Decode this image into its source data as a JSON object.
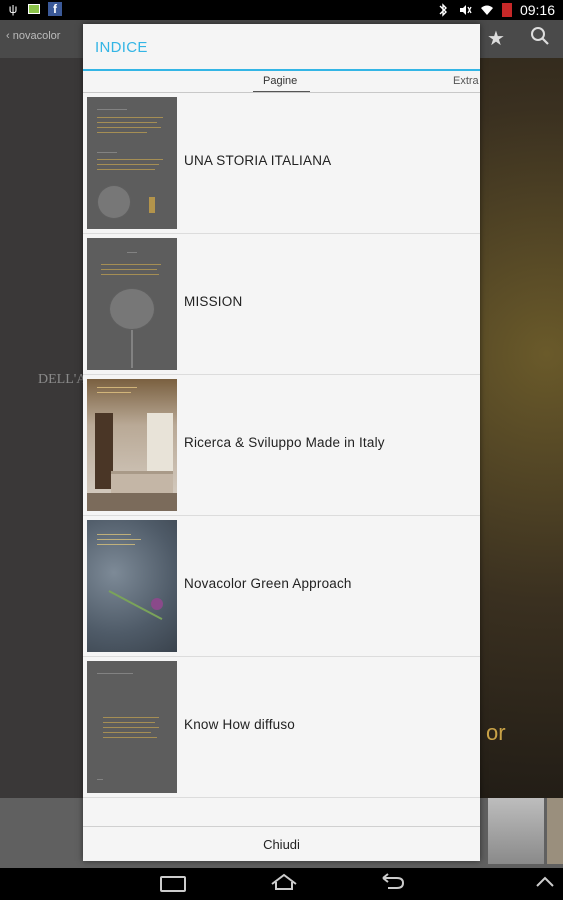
{
  "status_bar": {
    "time": "09:16",
    "icons_left": [
      "usb-icon",
      "battery-full-icon",
      "facebook-icon"
    ],
    "icons_right": [
      "bluetooth-icon",
      "mute-icon",
      "wifi-icon",
      "battery-low-icon"
    ],
    "facebook_glyph": "f",
    "usb_glyph": "ψ"
  },
  "background_app": {
    "back_label": "‹ novacolor",
    "left_text": "DELL'A",
    "right_text": "or"
  },
  "dialog": {
    "title": "INDICE",
    "tabs": [
      {
        "label": "Pagine",
        "selected": true
      },
      {
        "label": "Extra",
        "selected": false
      }
    ],
    "items": [
      {
        "title": "UNA STORIA ITALIANA"
      },
      {
        "title": "MISSION"
      },
      {
        "title": "Ricerca & Sviluppo Made in Italy"
      },
      {
        "title": "Novacolor Green Approach"
      },
      {
        "title": "Know How diffuso"
      }
    ],
    "close_label": "Chiudi"
  },
  "colors": {
    "accent": "#33b5e5",
    "dialog_bg": "#f5f5f5",
    "statusbar_bg": "#000000"
  }
}
